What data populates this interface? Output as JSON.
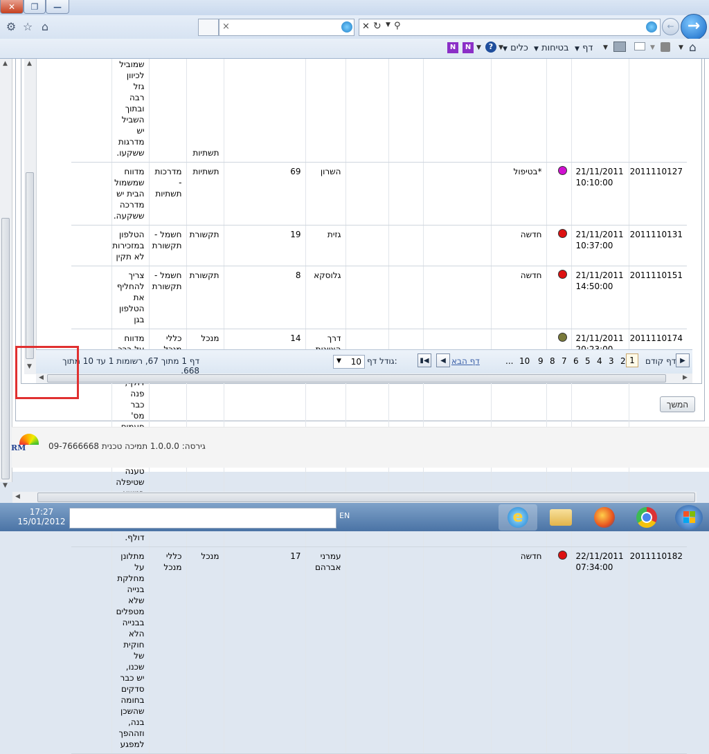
{
  "window": {
    "close": "✕",
    "restore": "❐",
    "minimize": "—"
  },
  "address_bar": {
    "value": "",
    "tab_close": "×"
  },
  "command_bar": {
    "tools": "כלים",
    "safety": "בטיחות",
    "page": "דף",
    "help": "?"
  },
  "grid": {
    "rows": [
      {
        "id": "",
        "date": "",
        "time": "",
        "dot": "",
        "status": "",
        "name": "",
        "num": "",
        "category": "תשתיות",
        "type": "",
        "desc": "שמוביל לכיוון גזל רבה ובתוך השביל יש מדרגות ששקעו."
      },
      {
        "id": "2011110127",
        "date": "21/11/2011",
        "time": "10:10:00",
        "dot": "#d010d0",
        "status": "*בטיפול",
        "name": "השרון",
        "num": "69",
        "category": "תשתיות",
        "type": "מדרכות - תשתיות",
        "desc": "מדווח שמשמול הבית יש מדרכה ששקעה."
      },
      {
        "id": "2011110131",
        "date": "21/11/2011",
        "time": "10:37:00",
        "dot": "#dd1111",
        "status": "חדשה",
        "name": "גזית",
        "num": "19",
        "category": "תקשורת",
        "type": "חשמל - תקשורת",
        "desc": "הטלפון במזכירות לא תקין"
      },
      {
        "id": "2011110151",
        "date": "21/11/2011",
        "time": "14:50:00",
        "dot": "#dd1111",
        "status": "חדשה",
        "name": "גלוסקא",
        "num": "8",
        "category": "תקשורת",
        "type": "חשמל - תקשורת",
        "desc": "צריך להחליף את הטלפון בגן"
      },
      {
        "id": "2011110174",
        "date": "21/11/2011",
        "time": "20:23:00",
        "dot": "#7a7a3a",
        "status": "",
        "name": "דרך הציונות",
        "num": "14",
        "category": "מנכל",
        "type": "כללי מנכל",
        "desc": "מדווח על ברכ כיבוי אש דולף, פנה כבר מס' פעמים בנושא והמחלקה המטפלת טענה שטיפלה בנושא אך הברז עדיין דולף."
      },
      {
        "id": "2011110182",
        "date": "22/11/2011",
        "time": "07:34:00",
        "dot": "#dd1111",
        "status": "חדשה",
        "name": "עמרני אברהם",
        "num": "17",
        "category": "מנכל",
        "type": "כללי מנכל",
        "desc": "מתלונן על מחלקת בנייה שלא מטפלים בבנייה הלא חוקית של שכנו, יש כבר סדקים בחומה שהשכן בנה, וזההפך למפגע"
      }
    ]
  },
  "pager": {
    "prev_label": "דף קודם",
    "current": "1",
    "pages": [
      "2",
      "3",
      "4",
      "5",
      "6",
      "7",
      "8",
      "9",
      "10",
      "..."
    ],
    "next_label": "דף הבא",
    "page_size_label": "גודל דף:",
    "page_size_value": "10",
    "summary": "דף 1 מתוך 67, רשומות 1 עד 10 מתוך 668."
  },
  "continue_button": "המשך",
  "footer": {
    "logo_text": "RM",
    "version_text": "גירסה: 1.0.0.0 תמיכה טכנית 09-7666668"
  },
  "taskbar": {
    "time": "17:27",
    "date": "15/01/2012",
    "language": "EN",
    "search_value": ""
  }
}
